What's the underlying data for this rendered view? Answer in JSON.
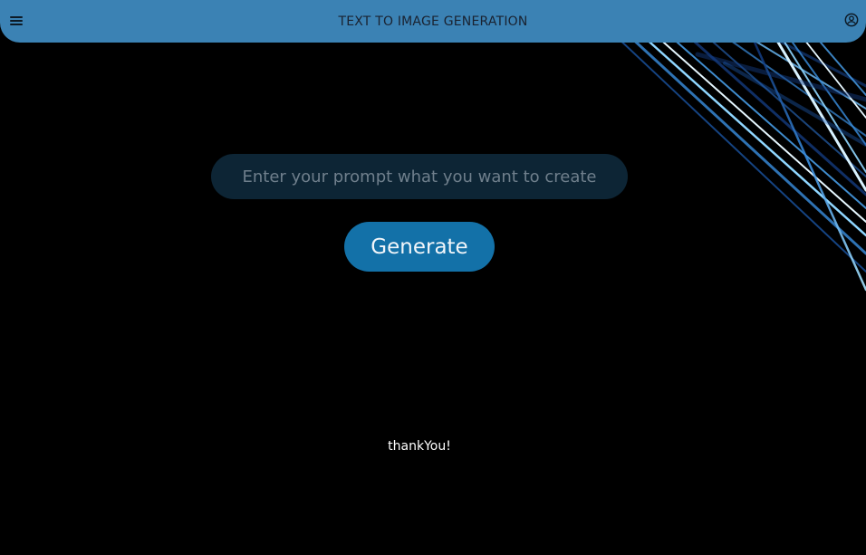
{
  "app_bar": {
    "title": "TEXT TO IMAGE GENERATION",
    "menu_icon": "hamburger-menu-icon",
    "account_icon": "account-circle-icon",
    "color": "#3b82b4"
  },
  "main": {
    "prompt_placeholder": "Enter your prompt what you want to create",
    "prompt_value": "",
    "generate_label": "Generate",
    "footer_text": "thankYou!"
  },
  "colors": {
    "background": "#000000",
    "input_bg": "#0d2535",
    "button_bg": "#1371a8",
    "streak_accent": "#5bb4f0"
  }
}
